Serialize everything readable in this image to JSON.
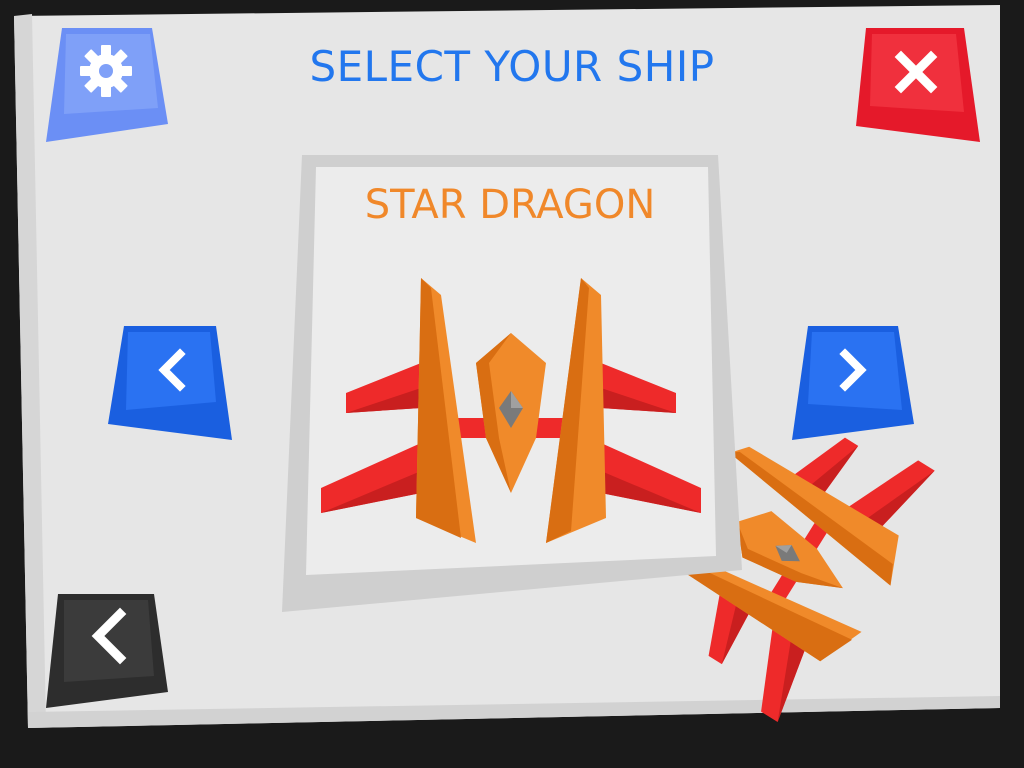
{
  "screen": {
    "title": "SELECT YOUR SHIP"
  },
  "ship": {
    "name": "STAR DRAGON"
  },
  "buttons": {
    "settings": {
      "icon": "gear-icon"
    },
    "close": {
      "icon": "close-icon"
    },
    "previous_ship": {
      "icon": "chevron-left-icon"
    },
    "next_ship": {
      "icon": "chevron-right-icon"
    },
    "back": {
      "icon": "chevron-left-icon"
    }
  },
  "colors": {
    "panel": "#e6e6e6",
    "title": "#2277ee",
    "ship_name": "#f0882a",
    "settings_button": "#6b8ff5",
    "close_button": "#e5192a",
    "nav_buttons": "#1a5fe0",
    "back_button": "#2d2d2d",
    "wing_red": "#ee2a2a",
    "body_orange": "#f08a2a"
  }
}
